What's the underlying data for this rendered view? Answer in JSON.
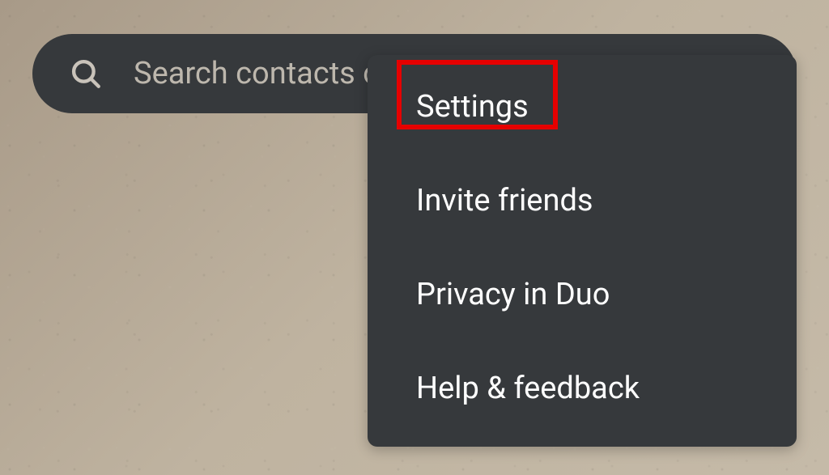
{
  "search": {
    "placeholder": "Search contacts or"
  },
  "icons": {
    "search": "search-icon"
  },
  "menu": {
    "items": [
      {
        "label": "Settings",
        "highlighted": true
      },
      {
        "label": "Invite friends",
        "highlighted": false
      },
      {
        "label": "Privacy in Duo",
        "highlighted": false
      },
      {
        "label": "Help & feedback",
        "highlighted": false
      }
    ]
  },
  "colors": {
    "panel": "#36393c",
    "text": "#fefefe",
    "placeholder": "#bdb7ad",
    "highlight": "#e60000"
  }
}
